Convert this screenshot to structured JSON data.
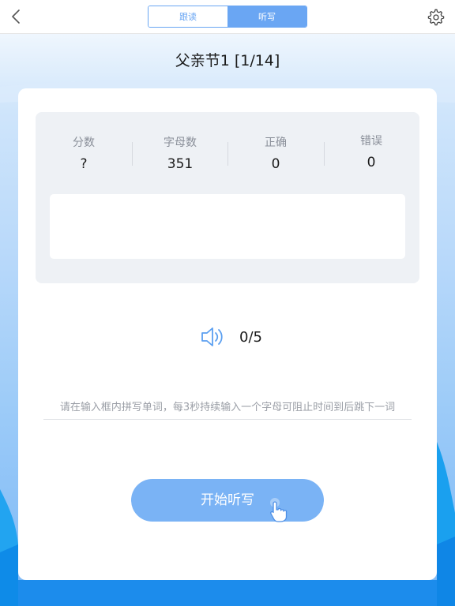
{
  "header": {
    "tabs": [
      {
        "label": "跟读",
        "active": false
      },
      {
        "label": "听写",
        "active": true
      }
    ],
    "back_icon": "chevron-left-icon",
    "settings_icon": "gear-icon"
  },
  "title": "父亲节1 [1/14]",
  "stats": [
    {
      "label": "分数",
      "value": "?"
    },
    {
      "label": "字母数",
      "value": "351"
    },
    {
      "label": "正确",
      "value": "0"
    },
    {
      "label": "错误",
      "value": "0"
    }
  ],
  "audio": {
    "icon": "speaker-icon",
    "progress": "0/5"
  },
  "hint": "请在输入框内拼写单词，每3秒持续输入一个字母可阻止时间到后跳下一词",
  "start_button": {
    "label": "开始听写",
    "icon": "hand-pointer-icon"
  },
  "colors": {
    "accent": "#6aa6f3",
    "button": "#7ab3f5",
    "panel": "#eef1f5"
  }
}
